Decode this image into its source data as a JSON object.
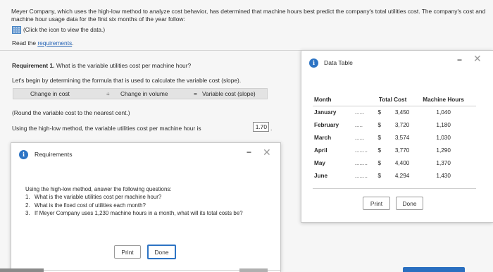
{
  "intro_text": "Meyer Company, which uses the high-low method to analyze cost behavior, has determined that machine hours best predict the company's total utilities cost. The company's cost and machine hour usage data for the first six months of the year follow:",
  "data_link": "(Click the icon to view the data.)",
  "read_prefix": "Read the",
  "read_link": "requirements",
  "read_suffix": ".",
  "requirement": {
    "bold": "Requirement 1.",
    "question": " What is the variable utilities cost per machine hour?"
  },
  "formula_intro": "Let's begin by determining the formula that is used to calculate the variable cost (slope).",
  "formula": {
    "left": "Change in cost",
    "op1": "÷",
    "middle": "Change in volume",
    "op2": "=",
    "right": "Variable cost (slope)"
  },
  "round_note": "(Round the variable cost to the nearest cent.)",
  "highlow_text": "Using the high-low method, the variable utilities cost per machine hour is",
  "answer_value": "1.70",
  "answer_suffix": ".",
  "requirements_modal": {
    "title": "Requirements",
    "intro": "Using the high-low method, answer the following questions:",
    "items": [
      {
        "num": "1.",
        "text": "What is the variable utilities cost per machine hour?"
      },
      {
        "num": "2.",
        "text": "What is the fixed cost of utilities each month?"
      },
      {
        "num": "3.",
        "text": "If Meyer Company uses 1,230 machine hours in a month, what will its total costs be?"
      }
    ],
    "print_label": "Print",
    "done_label": "Done"
  },
  "data_modal": {
    "title": "Data Table",
    "headers": {
      "month": "Month",
      "total_cost": "Total Cost",
      "machine_hours": "Machine Hours"
    },
    "rows": [
      {
        "month": "January",
        "dots": "......",
        "cur": "$",
        "cost": "3,450",
        "hours": "1,040"
      },
      {
        "month": "February",
        "dots": ".....",
        "cur": "$",
        "cost": "3,720",
        "hours": "1,180"
      },
      {
        "month": "March",
        "dots": "......",
        "cur": "$",
        "cost": "3,574",
        "hours": "1,030"
      },
      {
        "month": "April",
        "dots": "........",
        "cur": "$",
        "cost": "3,770",
        "hours": "1,290"
      },
      {
        "month": "May",
        "dots": "........",
        "cur": "$",
        "cost": "4,400",
        "hours": "1,370"
      },
      {
        "month": "June",
        "dots": "........",
        "cur": "$",
        "cost": "4,294",
        "hours": "1,430"
      }
    ],
    "print_label": "Print",
    "done_label": "Done"
  },
  "colors": {
    "accent": "#2d74c4",
    "link": "#2463b5"
  }
}
